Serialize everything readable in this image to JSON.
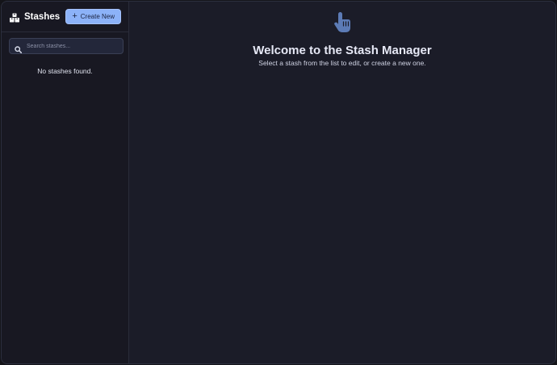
{
  "sidebar": {
    "title": "Stashes",
    "title_icon": "boxes-icon",
    "create_button_label": "Create New",
    "create_button_icon": "plus-icon",
    "search": {
      "placeholder": "Search stashes...",
      "value": ""
    },
    "empty_message": "No stashes found."
  },
  "main": {
    "icon": "pointing-hand-icon",
    "title": "Welcome to the Stash Manager",
    "subtitle": "Select a stash from the list to edit, or create a new one."
  },
  "colors": {
    "accent": "#8cb2f8",
    "background": "#1b1c28",
    "sidebar": "#181822",
    "hand_icon": "#5c7bb6"
  }
}
